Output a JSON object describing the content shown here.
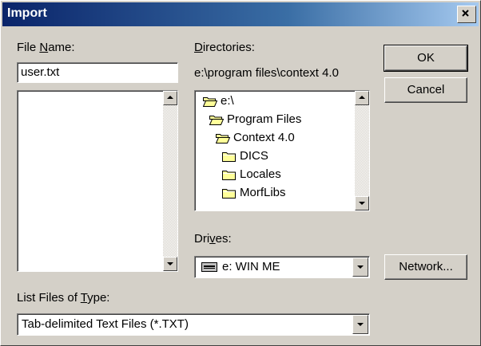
{
  "window": {
    "title": "Import"
  },
  "file_name": {
    "label_pre": "File ",
    "label_ul": "N",
    "label_post": "ame:",
    "value": "user.txt",
    "files": []
  },
  "directories": {
    "label_ul": "D",
    "label_post": "irectories:",
    "path": "e:\\program files\\context 4.0",
    "items": [
      {
        "name": "e:\\",
        "icon": "open-folder-icon"
      },
      {
        "name": "Program Files",
        "icon": "open-folder-icon"
      },
      {
        "name": "Context 4.0",
        "icon": "open-folder-icon"
      },
      {
        "name": "DICS",
        "icon": "folder-icon"
      },
      {
        "name": "Locales",
        "icon": "folder-icon"
      },
      {
        "name": "MorfLibs",
        "icon": "folder-icon"
      }
    ]
  },
  "buttons": {
    "ok": "OK",
    "cancel": "Cancel",
    "network": "Network..."
  },
  "drives": {
    "label_pre": "Dri",
    "label_ul": "v",
    "label_post": "es:",
    "value": "e: WIN ME",
    "icon": "drive-icon"
  },
  "file_type": {
    "label_pre": "List Files of ",
    "label_ul": "T",
    "label_post": "ype:",
    "value": "Tab-delimited Text Files (*.TXT)"
  },
  "colors": {
    "title_start": "#0a246a",
    "title_end": "#a6caf0",
    "face": "#d4d0c8",
    "folder": "#ffff99"
  }
}
